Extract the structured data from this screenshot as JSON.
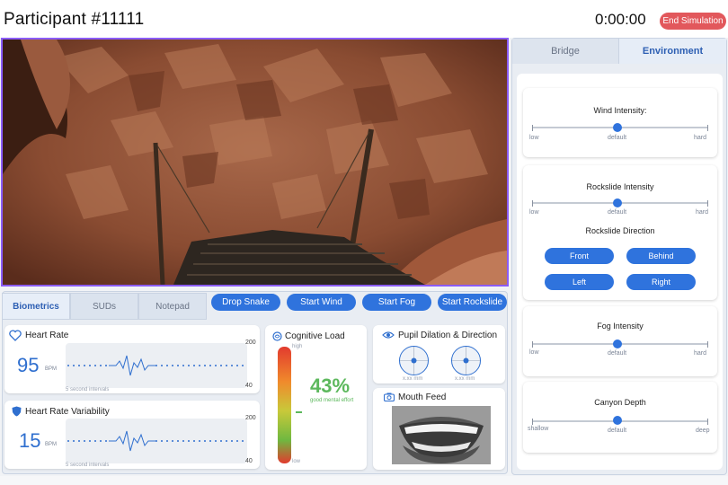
{
  "header": {
    "participant": "Participant #11111",
    "timer": "0:00:00",
    "end_button": "End Simulation"
  },
  "left_tabs": [
    "Biometrics",
    "SUDs",
    "Notepad"
  ],
  "actions": [
    "Drop Snake",
    "Start Wind",
    "Start Fog",
    "Start Rockslide"
  ],
  "heart_rate": {
    "title": "Heart Rate",
    "value": "95",
    "unit": "BPM",
    "scale_max": "200",
    "scale_min": "40",
    "note": "5 second intervals"
  },
  "hrv": {
    "title": "Heart Rate Variability",
    "value": "15",
    "unit": "BPM",
    "scale_max": "200",
    "scale_min": "40",
    "note": "5 second intervals"
  },
  "cognitive": {
    "title": "Cognitive Load",
    "high": "high",
    "low": "low",
    "percent": "43%",
    "caption": "good mental effort",
    "level": 0.43
  },
  "pupil": {
    "title": "Pupil Dilation & Direction",
    "left_value": "x.xx mm",
    "right_value": "x.xx mm"
  },
  "mouth": {
    "title": "Mouth Feed"
  },
  "right_tabs": [
    "Bridge",
    "Environment"
  ],
  "environment": {
    "wind": {
      "title": "Wind Intensity:",
      "min": "low",
      "mid": "default",
      "max": "hard"
    },
    "rockslide": {
      "title": "Rockslide Intensity",
      "min": "low",
      "mid": "default",
      "max": "hard"
    },
    "direction": {
      "title": "Rockslide Direction",
      "buttons": [
        "Front",
        "Behind",
        "Left",
        "Right"
      ]
    },
    "fog": {
      "title": "Fog Intensity",
      "min": "low",
      "mid": "default",
      "max": "hard"
    },
    "canyon": {
      "title": "Canyon Depth",
      "min": "shallow",
      "mid": "default",
      "max": "deep"
    }
  },
  "colors": {
    "accent": "#2f73dd",
    "end_button": "#e2585c",
    "frame": "#8b5cf6",
    "cognitive_value": "#5cb85c"
  }
}
